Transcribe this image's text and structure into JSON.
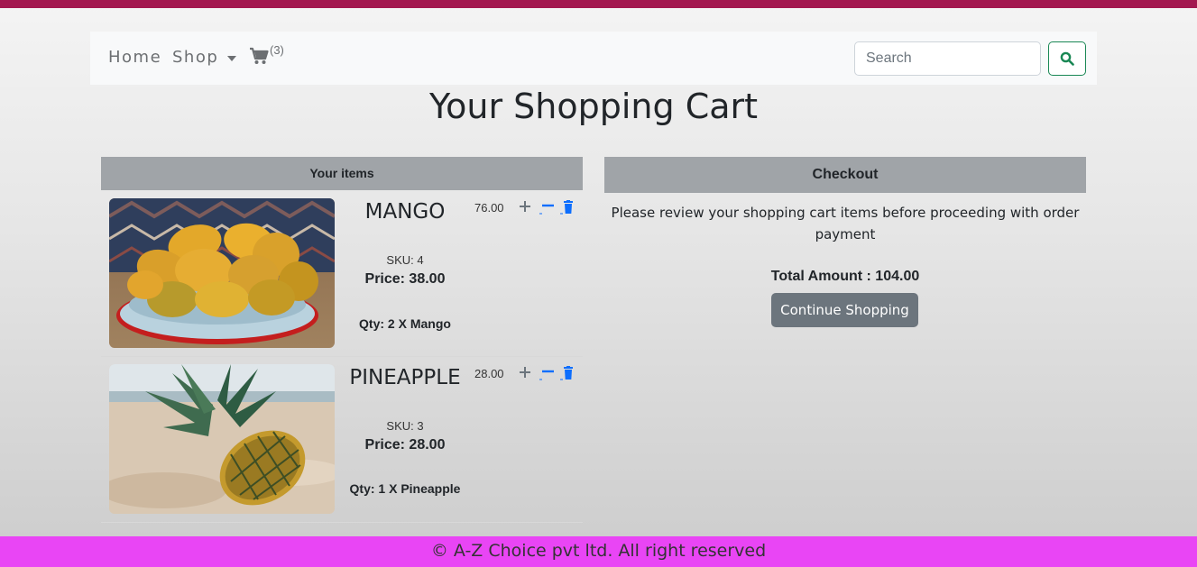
{
  "nav": {
    "home_label": "Home",
    "shop_label": "Shop",
    "cart_count": "(3)",
    "search_placeholder": "Search"
  },
  "page_title": "Your Shopping Cart",
  "items_header": "Your items",
  "items": [
    {
      "name": "MANGO",
      "line_total": "76.00",
      "sku": "SKU: 4",
      "price": "Price: 38.00",
      "qty": "Qty: 2 X Mango",
      "image": "mango-bowl-photo"
    },
    {
      "name": "PINEAPPLE",
      "line_total": "28.00",
      "sku": "SKU: 3",
      "price": "Price: 28.00",
      "qty": "Qty: 1 X Pineapple",
      "image": "pineapple-beach-photo"
    }
  ],
  "checkout": {
    "header": "Checkout",
    "note": "Please review your shopping cart items before proceeding with order payment",
    "total": "Total Amount : 104.00",
    "continue_label": "Continue Shopping"
  },
  "footer": "© A-Z Choice pvt ltd. All right reserved",
  "colors": {
    "topbar": "#a3174f",
    "footer": "#e945f5",
    "action_icon": "#0d6efd",
    "search_button": "#198754",
    "continue_button": "#6c757d"
  }
}
